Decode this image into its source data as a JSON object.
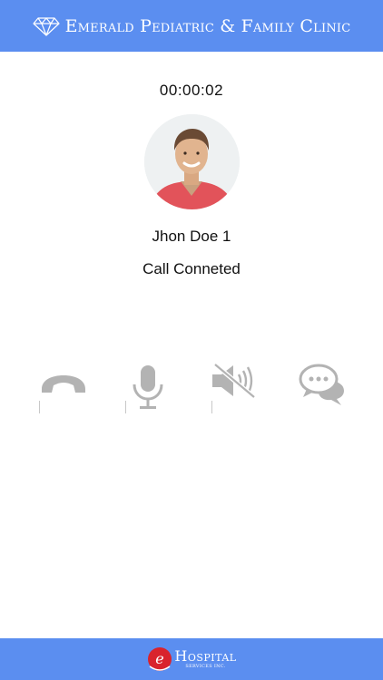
{
  "header": {
    "title": "Emerald Pediatric & Family Clinic",
    "icon": "diamond-icon"
  },
  "call": {
    "timer": "00:00:02",
    "contact_name": "Jhon Doe 1",
    "status": "Call Conneted"
  },
  "controls": [
    {
      "name": "end-call",
      "icon": "phone-icon"
    },
    {
      "name": "mute",
      "icon": "microphone-icon"
    },
    {
      "name": "speaker",
      "icon": "speaker-muted-icon"
    },
    {
      "name": "chat",
      "icon": "chat-bubbles-icon"
    }
  ],
  "footer": {
    "logo_letter": "e",
    "logo_text": "Hospital",
    "logo_subtext": "SERVICES INC."
  },
  "colors": {
    "brand": "#5b8ef0",
    "icon_gray": "#b3b3b3",
    "logo_red": "#d9232d"
  }
}
